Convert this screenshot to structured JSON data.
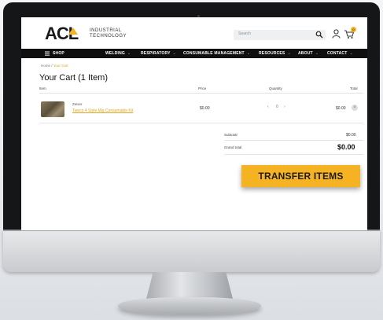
{
  "header": {
    "logo": {
      "brand": "ACL",
      "line1": "INDUSTRIAL",
      "line2": "TECHNOLOGY"
    },
    "search_placeholder": "Search",
    "cart_count": "0"
  },
  "nav": {
    "items": [
      {
        "label": "SHOP"
      },
      {
        "label": "WELDING"
      },
      {
        "label": "RESPIRATORY"
      },
      {
        "label": "CONSUMABLE MANAGEMENT"
      },
      {
        "label": "RESOURCES"
      },
      {
        "label": "ABOUT"
      },
      {
        "label": "CONTACT"
      }
    ]
  },
  "breadcrumb": {
    "home": "Home",
    "sep": "/",
    "current": "Your Cart"
  },
  "cart": {
    "title": "Your Cart (1 Item)",
    "columns": {
      "item": "Item",
      "price": "Price",
      "quantity": "Quantity",
      "total": "Total"
    },
    "items": [
      {
        "brand": "Zeiser",
        "name": "Tweco 4 Style Mig Consumable Kit",
        "price": "$0.00",
        "qty": "0",
        "total": "$0.00"
      }
    ],
    "subtotal_label": "Subtotal",
    "subtotal_value": "$0.00",
    "grand_label": "Grand total",
    "grand_value": "$0.00"
  },
  "actions": {
    "transfer_label": "TRANSFER ITEMS"
  },
  "colors": {
    "accent": "#f5b324",
    "nav_bg": "#0f0f10"
  }
}
